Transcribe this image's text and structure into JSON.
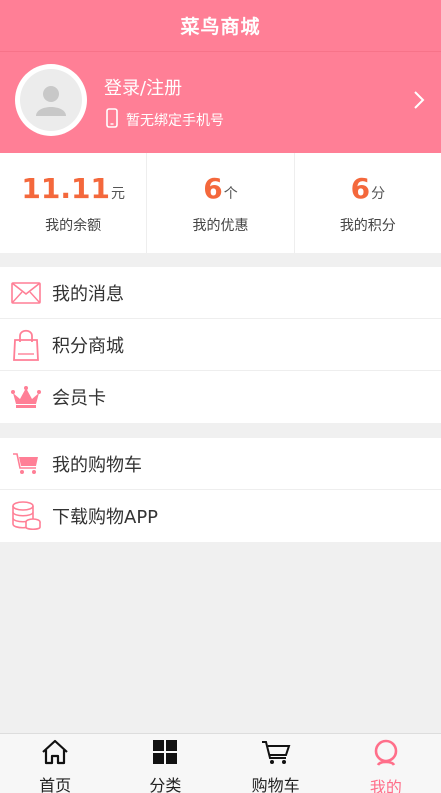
{
  "header": {
    "title": "菜鸟商城"
  },
  "profile": {
    "login_label": "登录/注册",
    "phone_label": "暂无绑定手机号",
    "avatar_icon": "user-avatar-icon",
    "chevron_icon": "chevron-right-icon"
  },
  "stats": [
    {
      "value": "11.11",
      "unit": "元",
      "label": "我的余额"
    },
    {
      "value": "6",
      "unit": "个",
      "label": "我的优惠"
    },
    {
      "value": "6",
      "unit": "分",
      "label": "我的积分"
    }
  ],
  "menu_group_1": [
    {
      "label": "我的消息",
      "icon": "mail-icon"
    },
    {
      "label": "积分商城",
      "icon": "shopping-bag-icon"
    },
    {
      "label": "会员卡",
      "icon": "crown-icon"
    }
  ],
  "menu_group_2": [
    {
      "label": "我的购物车",
      "icon": "cart-icon"
    },
    {
      "label": "下载购物APP",
      "icon": "database-icon"
    }
  ],
  "tabbar": [
    {
      "label": "首页",
      "icon": "home-icon",
      "active": false
    },
    {
      "label": "分类",
      "icon": "grid-icon",
      "active": false
    },
    {
      "label": "购物车",
      "icon": "cart-icon",
      "active": false
    },
    {
      "label": "我的",
      "icon": "profile-icon",
      "active": true
    }
  ],
  "colors": {
    "accent": "#ff7f96",
    "value_orange": "#f4683c",
    "active_tab": "#ff6f8a"
  }
}
